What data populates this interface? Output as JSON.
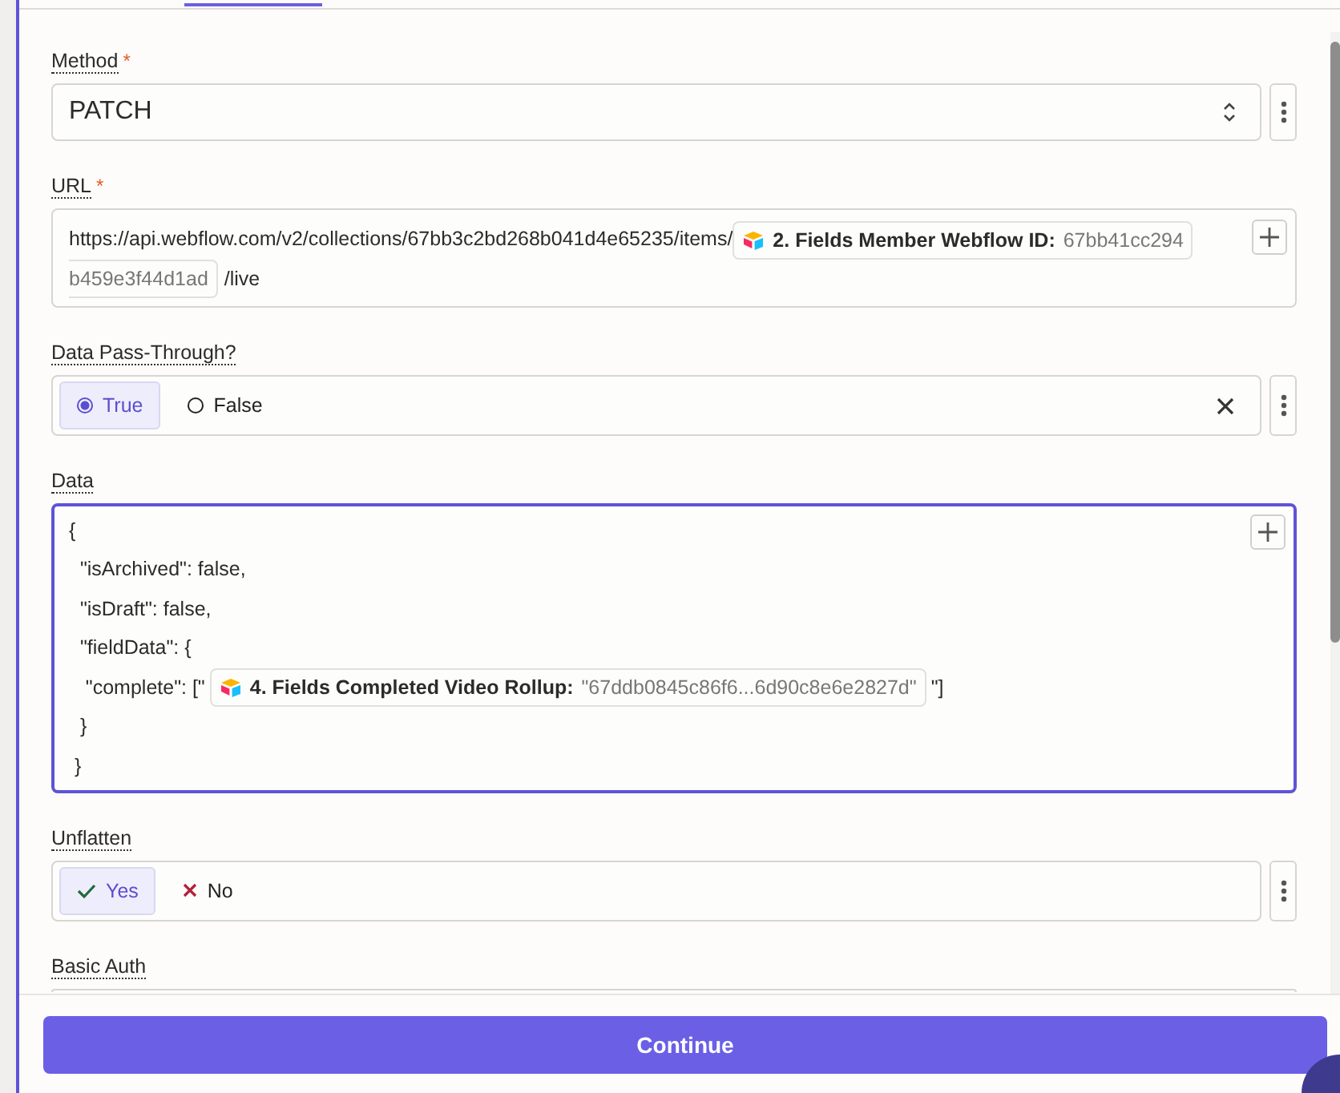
{
  "fields": [
    {
      "kind": "select",
      "label": "Method",
      "required_mark": "*",
      "value": "PATCH",
      "menu": true
    },
    {
      "kind": "tokens",
      "label": "URL",
      "required_mark": "*",
      "menu": false,
      "parts": [
        {
          "kind": "text",
          "text": "https://api.webflow.com/v2/collections/67bb3c2bd268b041d4e65235/items/"
        },
        {
          "kind": "pill",
          "title": "2. Fields Member Webflow ID:",
          "value": "67bb41cc294"
        },
        {
          "kind": "pill_rest",
          "value": "b459e3f44d1ad"
        },
        {
          "kind": "text",
          "text": "/live"
        }
      ]
    },
    {
      "kind": "radio",
      "label": "Data Pass-Through?",
      "menu": true,
      "clearable": true,
      "options": [
        {
          "label": "True",
          "selected": true
        },
        {
          "label": "False",
          "selected": false
        }
      ]
    },
    {
      "kind": "code",
      "label": "Data",
      "menu": false,
      "focused": true,
      "lines": [
        [
          {
            "kind": "text",
            "text": "{"
          }
        ],
        [
          {
            "kind": "text",
            "text": "  \"isArchived\": false,"
          }
        ],
        [
          {
            "kind": "text",
            "text": "  \"isDraft\": false,"
          }
        ],
        [
          {
            "kind": "text",
            "text": "  \"fieldData\": {"
          }
        ],
        [
          {
            "kind": "text",
            "text": "   \"complete\": [\""
          },
          {
            "kind": "pill",
            "title": "4. Fields Completed Video Rollup:",
            "value": "\"67ddb0845c86f6...6d90c8e6e2827d\""
          },
          {
            "kind": "text",
            "text": "\"]"
          }
        ],
        [
          {
            "kind": "text",
            "text": "  }"
          }
        ],
        [
          {
            "kind": "text",
            "text": " }"
          }
        ]
      ]
    },
    {
      "kind": "toggle",
      "label": "Unflatten",
      "menu": true,
      "options": [
        {
          "kind": "yes",
          "label": "Yes",
          "selected": true
        },
        {
          "kind": "no",
          "label": "No",
          "selected": false
        }
      ]
    },
    {
      "kind": "cut",
      "label": "Basic Auth",
      "menu": false
    }
  ],
  "continue_button": "Continue"
}
